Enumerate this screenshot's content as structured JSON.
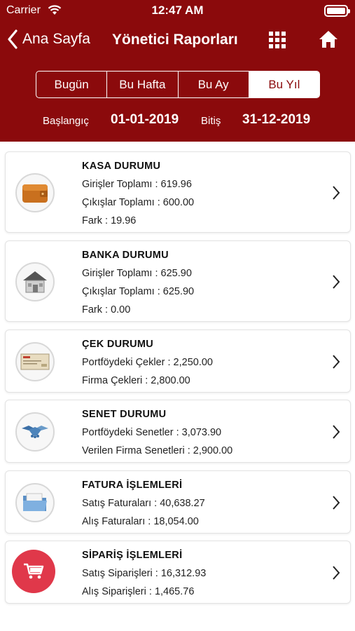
{
  "status_bar": {
    "carrier": "Carrier",
    "time": "12:47 AM"
  },
  "nav": {
    "back_label": "Ana Sayfa",
    "title": "Yönetici Raporları"
  },
  "segments": [
    {
      "label": "Bugün",
      "selected": false
    },
    {
      "label": "Bu Hafta",
      "selected": false
    },
    {
      "label": "Bu Ay",
      "selected": false
    },
    {
      "label": "Bu Yıl",
      "selected": true
    }
  ],
  "date_range": {
    "start_label": "Başlangıç",
    "start_value": "01-01-2019",
    "end_label": "Bitiş",
    "end_value": "31-12-2019"
  },
  "reports": [
    {
      "title": "KASA DURUMU",
      "icon": "wallet-icon",
      "lines": [
        "Girişler Toplamı : 619.96",
        "Çıkışlar Toplamı : 600.00",
        "Fark : 19.96"
      ]
    },
    {
      "title": "BANKA DURUMU",
      "icon": "bank-building-icon",
      "lines": [
        "Girişler Toplamı : 625.90",
        "Çıkışlar Toplamı : 625.90",
        "Fark : 0.00"
      ]
    },
    {
      "title": "ÇEK DURUMU",
      "icon": "check-icon",
      "lines": [
        "Portföydeki Çekler : 2,250.00",
        "Firma Çekleri : 2,800.00"
      ]
    },
    {
      "title": "SENET DURUMU",
      "icon": "handshake-icon",
      "lines": [
        "Portföydeki Senetler : 3,073.90",
        "Verilen Firma Senetleri : 2,900.00"
      ]
    },
    {
      "title": "FATURA İŞLEMLERİ",
      "icon": "folder-icon",
      "lines": [
        "Satış Faturaları : 40,638.27",
        "Alış Faturaları  : 18,054.00"
      ]
    },
    {
      "title": "SİPARİŞ İŞLEMLERİ",
      "icon": "shopping-cart-icon",
      "lines": [
        "Satış Siparişleri : 16,312.93",
        "Alış Siparişleri  : 1,465.76"
      ]
    }
  ],
  "colors": {
    "header_bg": "#8b0a0c",
    "cart_badge": "#e0384a"
  }
}
